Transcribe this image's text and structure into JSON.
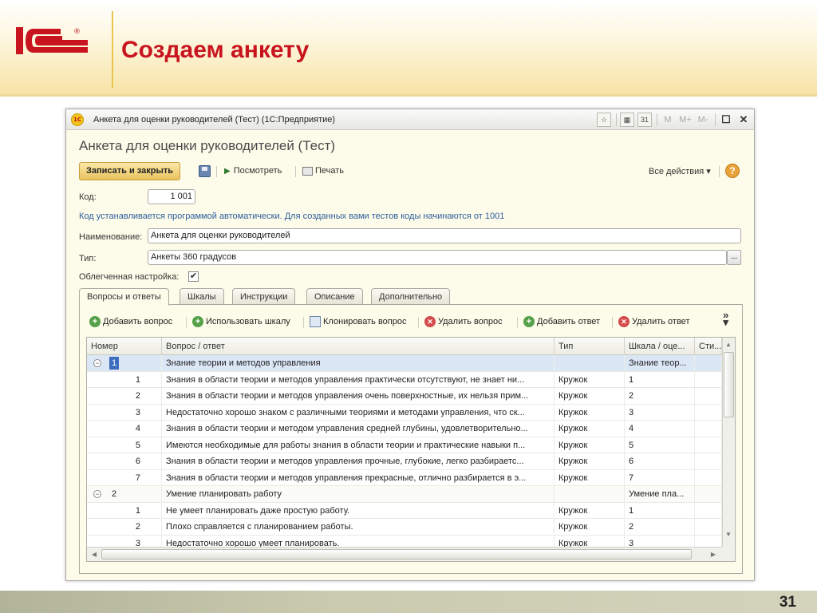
{
  "slide": {
    "title": "Создаем анкету",
    "page_number": "31",
    "brand_colors": {
      "title_red": "#c8141e",
      "logo_red": "#c8141e",
      "header_yellow": "#f7e3a6"
    }
  },
  "window": {
    "title": "Анкета для оценки руководителей (Тест)  (1С:Предприятие)",
    "icons": [
      "bookmark-icon",
      "calculator-icon",
      "calendar-icon"
    ],
    "memory_buttons": [
      "M",
      "M+",
      "M-"
    ],
    "calendar_day": "31"
  },
  "form": {
    "title": "Анкета для оценки руководителей (Тест)",
    "toolbar": {
      "save_close_label": "Записать и закрыть",
      "view_label": "Посмотреть",
      "print_label": "Печать",
      "all_actions_label": "Все действия",
      "help_label": "?"
    },
    "code_label": "Код:",
    "code_value": "1 001",
    "code_hint": "Код устанавливается программой автоматически. Для созданных вами тестов коды начинаются от 1001",
    "name_label": "Наименование:",
    "name_value": "Анкета для оценки руководителей",
    "type_label": "Тип:",
    "type_value": "Анкеты 360 градусов",
    "type_button_label": "...",
    "simple_setup_label": "Облегченная настройка:",
    "simple_setup_checked": true,
    "checkbox_mark": "✔"
  },
  "tabs": [
    "Вопросы и ответы",
    "Шкалы",
    "Инструкции",
    "Описание",
    "Дополнительно"
  ],
  "active_tab": 0,
  "grid_toolbar": {
    "add_question": "Добавить вопрос",
    "use_scale": "Использовать шкалу",
    "clone_question": "Клонировать вопрос",
    "delete_question": "Удалить вопрос",
    "add_answer": "Добавить ответ",
    "delete_answer": "Удалить ответ",
    "more": "»"
  },
  "grid": {
    "columns": [
      "Номер",
      "Вопрос / ответ",
      "Тип",
      "Шкала / оце...",
      "Сти..."
    ],
    "rows": [
      {
        "kind": "group",
        "selected": true,
        "num": "1",
        "text": "Знание теории и методов управления",
        "type": "",
        "scale": "Знание теор...",
        "style": ""
      },
      {
        "kind": "item",
        "num": "1",
        "text": "Знания в области теории и методов управления практически отсутствуют, не знает ни...",
        "type": "Кружок",
        "scale": "1",
        "style": ""
      },
      {
        "kind": "item",
        "num": "2",
        "text": "Знания в области теории и методов управления очень поверхностные, их нельзя прим...",
        "type": "Кружок",
        "scale": "2",
        "style": ""
      },
      {
        "kind": "item",
        "num": "3",
        "text": "Недостаточно хорошо знаком с различными теориями и методами управления, что ск...",
        "type": "Кружок",
        "scale": "3",
        "style": ""
      },
      {
        "kind": "item",
        "num": "4",
        "text": "Знания в области теории и методом управления средней глубины, удовлетворительно...",
        "type": "Кружок",
        "scale": "4",
        "style": ""
      },
      {
        "kind": "item",
        "num": "5",
        "text": "Имеются необходимые для работы знания в области теории и практические навыки п...",
        "type": "Кружок",
        "scale": "5",
        "style": ""
      },
      {
        "kind": "item",
        "num": "6",
        "text": "Знания в области теории и методов управления прочные, глубокие, легко разбираетс...",
        "type": "Кружок",
        "scale": "6",
        "style": ""
      },
      {
        "kind": "item",
        "num": "7",
        "text": "Знания в области теории и методов управления прекрасные, отлично разбирается в э...",
        "type": "Кружок",
        "scale": "7",
        "style": ""
      },
      {
        "kind": "group",
        "selected": false,
        "num": "2",
        "text": "Умение планировать работу",
        "type": "",
        "scale": "Умение пла...",
        "style": ""
      },
      {
        "kind": "item",
        "num": "1",
        "text": "Не умеет планировать даже простую работу.",
        "type": "Кружок",
        "scale": "1",
        "style": ""
      },
      {
        "kind": "item",
        "num": "2",
        "text": "Плохо справляется с планированием работы.",
        "type": "Кружок",
        "scale": "2",
        "style": ""
      },
      {
        "kind": "item",
        "num": "3",
        "text": "Недостаточно хорошо умеет планировать.",
        "type": "Кружок",
        "scale": "3",
        "style": ""
      }
    ]
  }
}
